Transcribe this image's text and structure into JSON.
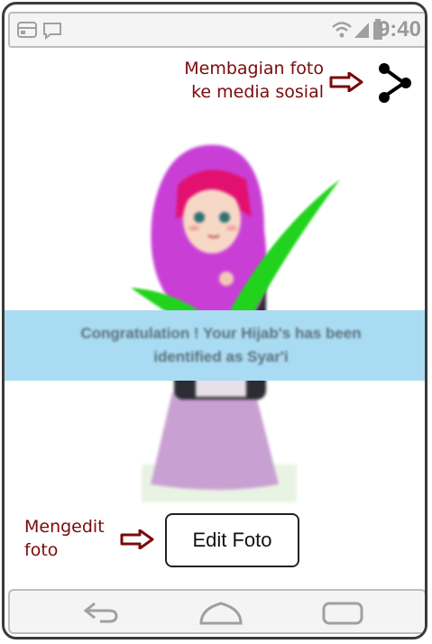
{
  "status_bar": {
    "time": "9:40",
    "icons": [
      "app-window-icon",
      "message-icon",
      "wifi-icon",
      "signal-icon",
      "battery-icon"
    ]
  },
  "annotations": {
    "share_note_line1": "Membagian foto",
    "share_note_line2": "ke media sosial",
    "edit_note_line1": "Mengedit",
    "edit_note_line2": "foto"
  },
  "result": {
    "message_line1": "Congratulation ! Your Hijab's has been",
    "message_line2": "identified as Syar'i"
  },
  "actions": {
    "share_icon": "share-icon",
    "edit_label": "Edit Foto"
  },
  "nav_bar": {
    "icons": [
      "back-icon",
      "home-icon",
      "recents-icon"
    ]
  },
  "colors": {
    "annotation": "#7a0a0a",
    "banner": "#a9dcf3",
    "check": "#22d31e",
    "hijab": "#c93fd6"
  }
}
